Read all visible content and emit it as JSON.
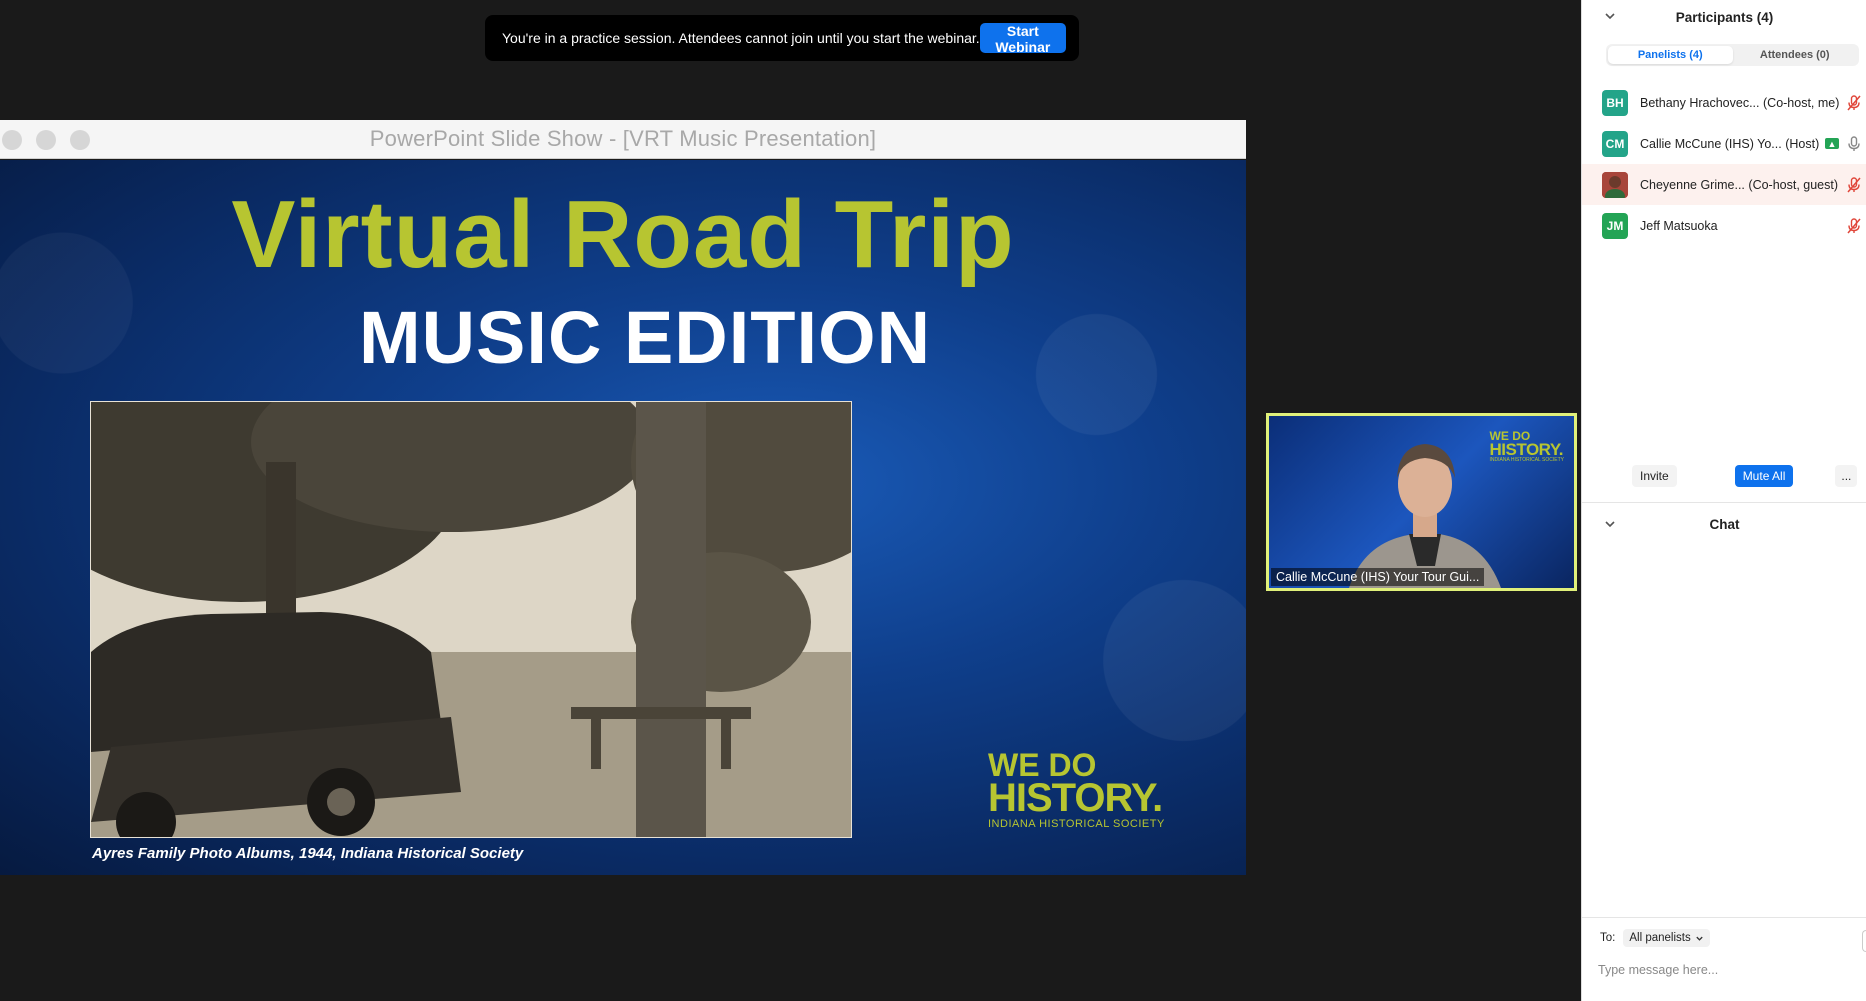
{
  "banner": {
    "text": "You're in a practice session. Attendees cannot join until you start the webinar.",
    "button_label": "Start Webinar"
  },
  "slideshow": {
    "window_title": "PowerPoint Slide Show - [VRT Music Presentation]",
    "heading": "Virtual Road Trip",
    "subheading": "MUSIC EDITION",
    "caption": "Ayres Family Photo Albums, 1944, Indiana Historical Society",
    "logo": {
      "line1": "WE DO",
      "line2": "HISTORY.",
      "line3": "INDIANA HISTORICAL SOCIETY"
    }
  },
  "video": {
    "name_label": "Callie McCune (IHS) Your Tour Gui...",
    "logo": {
      "line1": "WE DO",
      "line2": "HISTORY.",
      "line3": "INDIANA HISTORICAL SOCIETY"
    }
  },
  "participants": {
    "title": "Participants (4)",
    "tabs": [
      {
        "label": "Panelists (4)",
        "active": true
      },
      {
        "label": "Attendees (0)",
        "active": false
      }
    ],
    "list": [
      {
        "initials": "BH",
        "name": "Bethany Hrachovec...",
        "role": "(Co-host, me)",
        "avatar_color": "#23a489",
        "mic": "muted"
      },
      {
        "initials": "CM",
        "name": "Callie McCune (IHS) Yo...",
        "role": "(Host)",
        "avatar_color": "#23a489",
        "mic": "on",
        "sharing": true
      },
      {
        "initials": "",
        "name": "Cheyenne Grime...",
        "role": "(Co-host, guest)",
        "avatar_color": "#b0443a",
        "mic": "muted",
        "photo": true
      },
      {
        "initials": "JM",
        "name": "Jeff Matsuoka",
        "role": "",
        "avatar_color": "#23a455",
        "mic": "muted"
      }
    ],
    "actions": {
      "invite": "Invite",
      "mute_all": "Mute All",
      "more": "..."
    }
  },
  "chat": {
    "title": "Chat",
    "to_label": "To:",
    "to_value": "All panelists",
    "input_placeholder": "Type message here..."
  },
  "colors": {
    "accent": "#0e72ed",
    "slide_green": "#b7c531",
    "active_speaker_border": "#e0f07a",
    "muted_icon": "#e0463a"
  }
}
